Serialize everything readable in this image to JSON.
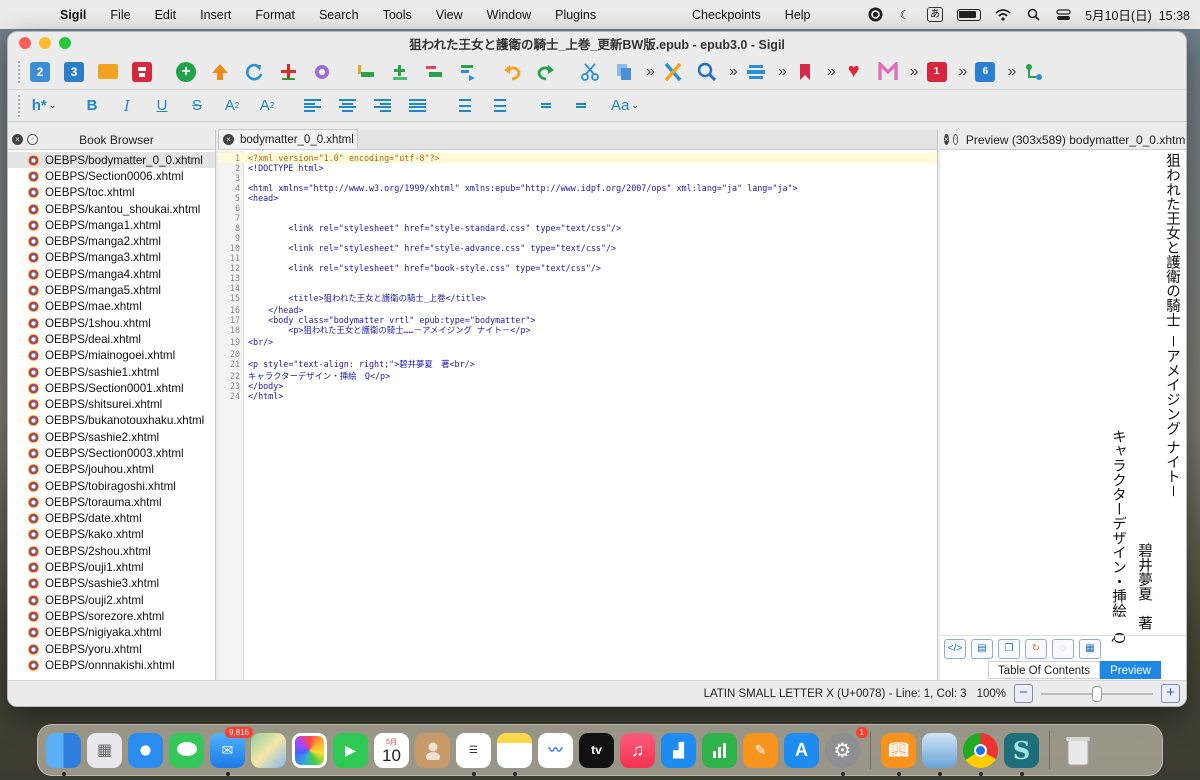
{
  "menubar": {
    "app_name": "Sigil",
    "menus": [
      "File",
      "Edit",
      "Insert",
      "Format",
      "Search",
      "Tools",
      "View",
      "Window",
      "Plugins"
    ],
    "extra_menus": [
      "Checkpoints",
      "Help"
    ],
    "ime_label": "あ",
    "clock": "5月10日(日)  15:38"
  },
  "window": {
    "title": "狙われた王女と護衛の騎士_上巻_更新BW版.epub - epub3.0 - Sigil"
  },
  "toolbar1": {
    "icons": [
      "new-epub2-icon",
      "new-epub3-icon",
      "open-folder-icon",
      "save-icon",
      "add-file-icon",
      "add-existing-icon",
      "undo-history-icon",
      "add-cover-icon",
      "settings-icon",
      "insert-file-icon",
      "add-plus-icon",
      "remove-icon",
      "merge-icon",
      "undo-icon",
      "redo-icon",
      "cut-icon",
      "copy-icon",
      "cross-icon",
      "search-icon",
      "list-icon",
      "bookmark-icon",
      "heart-icon",
      "metadata-icon",
      "plugin-icon",
      "plugin-6-icon",
      "tree-icon"
    ],
    "plugin_badges": [
      "1",
      "6"
    ],
    "tile_labels": {
      "new_epub2": "2",
      "new_epub3": "3"
    }
  },
  "toolbar2": {
    "heading_label": "h*",
    "bold": "B",
    "italic": "I",
    "underline": "U",
    "strike": "S",
    "subscript_base": "A",
    "subscript": "2",
    "superscript_base": "A",
    "superscript": "2",
    "case_label": "Aa"
  },
  "book_browser": {
    "title": "Book Browser",
    "files": [
      "OEBPS/bodymatter_0_0.xhtml",
      "OEBPS/Section0006.xhtml",
      "OEBPS/toc.xhtml",
      "OEBPS/kantou_shoukai.xhtml",
      "OEBPS/manga1.xhtml",
      "OEBPS/manga2.xhtml",
      "OEBPS/manga3.xhtml",
      "OEBPS/manga4.xhtml",
      "OEBPS/manga5.xhtml",
      "OEBPS/mae.xhtml",
      "OEBPS/1shou.xhtml",
      "OEBPS/deai.xhtml",
      "OEBPS/miainogoei.xhtml",
      "OEBPS/sashie1.xhtml",
      "OEBPS/Section0001.xhtml",
      "OEBPS/shitsurei.xhtml",
      "OEBPS/bukanotouxhaku.xhtml",
      "OEBPS/sashie2.xhtml",
      "OEBPS/Section0003.xhtml",
      "OEBPS/jouhou.xhtml",
      "OEBPS/tobiragoshi.xhtml",
      "OEBPS/torauma.xhtml",
      "OEBPS/date.xhtml",
      "OEBPS/kako.xhtml",
      "OEBPS/2shou.xhtml",
      "OEBPS/ouji1.xhtml",
      "OEBPS/sashie3.xhtml",
      "OEBPS/ouji2.xhtml",
      "OEBPS/sorezore.xhtml",
      "OEBPS/nigiyaka.xhtml",
      "OEBPS/yoru.xhtml",
      "OEBPS/onnnakishi.xhtml"
    ],
    "selected_index": 0
  },
  "editor": {
    "tab_label": "bodymatter_0_0.xhtml",
    "line_numbers": [
      "1",
      "2",
      "3",
      "4",
      "5",
      "6",
      "7",
      "8",
      "9",
      "10",
      "11",
      "12",
      "13",
      "14",
      "15",
      "16",
      "17",
      "18",
      "19",
      "20",
      "21",
      "22",
      "23",
      "24"
    ],
    "lines": [
      {
        "n": "1",
        "t": "<?xml version=\"1.0\" encoding=\"utf-8\"?>",
        "cls": "pi"
      },
      {
        "n": "2",
        "t": "<!DOCTYPE html>",
        "cls": "tg"
      },
      {
        "n": "3",
        "t": "",
        "cls": ""
      },
      {
        "n": "4",
        "t": "<html xmlns=\"http://www.w3.org/1999/xhtml\" xmlns:epub=\"http://www.idpf.org/2007/ops\" xml:lang=\"ja\" lang=\"ja\">",
        "cls": "tg"
      },
      {
        "n": "5",
        "t": "<head>",
        "cls": "tg"
      },
      {
        "n": "6",
        "t": "",
        "cls": ""
      },
      {
        "n": "7",
        "t": "",
        "cls": ""
      },
      {
        "n": "8",
        "t": "        <link rel=\"stylesheet\" href=\"style-standard.css\" type=\"text/css\"/>",
        "cls": "tg"
      },
      {
        "n": "9",
        "t": "",
        "cls": ""
      },
      {
        "n": "10",
        "t": "        <link rel=\"stylesheet\" href=\"style-advance.css\" type=\"text/css\"/>",
        "cls": "tg"
      },
      {
        "n": "11",
        "t": "",
        "cls": ""
      },
      {
        "n": "12",
        "t": "        <link rel=\"stylesheet\" href=\"book-style.css\" type=\"text/css\"/>",
        "cls": "tg"
      },
      {
        "n": "13",
        "t": "",
        "cls": ""
      },
      {
        "n": "14",
        "t": "",
        "cls": ""
      },
      {
        "n": "15",
        "t": "        <title>狙われた王女と護衛の騎士_上巻</title>",
        "cls": "tg"
      },
      {
        "n": "16",
        "t": "    </head>",
        "cls": "tg"
      },
      {
        "n": "17",
        "t": "    <body class=\"bodymatter vrtl\" epub:type=\"bodymatter\">",
        "cls": "tg"
      },
      {
        "n": "18",
        "t": "        <p>狙われた王女と護衛の騎士……－アメイジング ナイト－</p>",
        "cls": "tg"
      },
      {
        "n": "19",
        "t": "<br/>",
        "cls": "tg"
      },
      {
        "n": "20",
        "t": "",
        "cls": ""
      },
      {
        "n": "21",
        "t": "<p style=\"text-align: right;\">碧井夢夏　著<br/>",
        "cls": "tg"
      },
      {
        "n": "22",
        "t": "キャラクターデザイン・挿絵　Q</p>",
        "cls": "tg"
      },
      {
        "n": "23",
        "t": "</body>",
        "cls": "tg"
      },
      {
        "n": "24",
        "t": "</html>",
        "cls": "tg"
      }
    ]
  },
  "preview": {
    "title": "Preview (303x589) bodymatter_0_0.xhtml",
    "vertical_text": {
      "col1": "狙われた王女と護衛の騎士",
      "col2": "－アメイジング ナイト－",
      "col3": "キャラクターデザイン・挿絵　Q",
      "col4": "碧井夢夏　著"
    },
    "tabs": [
      "Table Of Contents",
      "Preview"
    ],
    "active_tab": "Preview"
  },
  "status": {
    "text": "LATIN SMALL LETTER X (U+0078) - Line: 1, Col: 3",
    "zoom": "100%",
    "zoom_fraction": 0.5,
    "zoom_minus": "−",
    "zoom_plus": "+"
  },
  "dock": {
    "apps": [
      "finder-icon",
      "launchpad-icon",
      "safari-icon",
      "messages-icon",
      "mail-icon",
      "maps-icon",
      "photos-icon",
      "facetime-icon",
      "calendar-icon",
      "contacts-icon",
      "reminders-icon",
      "notes-icon",
      "freeform-icon",
      "appletv-icon",
      "music-icon",
      "keynote-icon",
      "numbers-icon",
      "pages-icon",
      "appstore-icon",
      "systemsettings-icon",
      "books-icon",
      "preview-icon",
      "chrome-icon",
      "sigil-icon",
      "trash-icon"
    ],
    "mail_badge": "9,816",
    "settings_badge": "1",
    "calendar_month": "5月",
    "calendar_day": "10",
    "tv_label": "tv",
    "sigil_label": "S"
  },
  "colors": {
    "accent_blue": "#1e88e5",
    "menu_bg": "#ececec"
  }
}
